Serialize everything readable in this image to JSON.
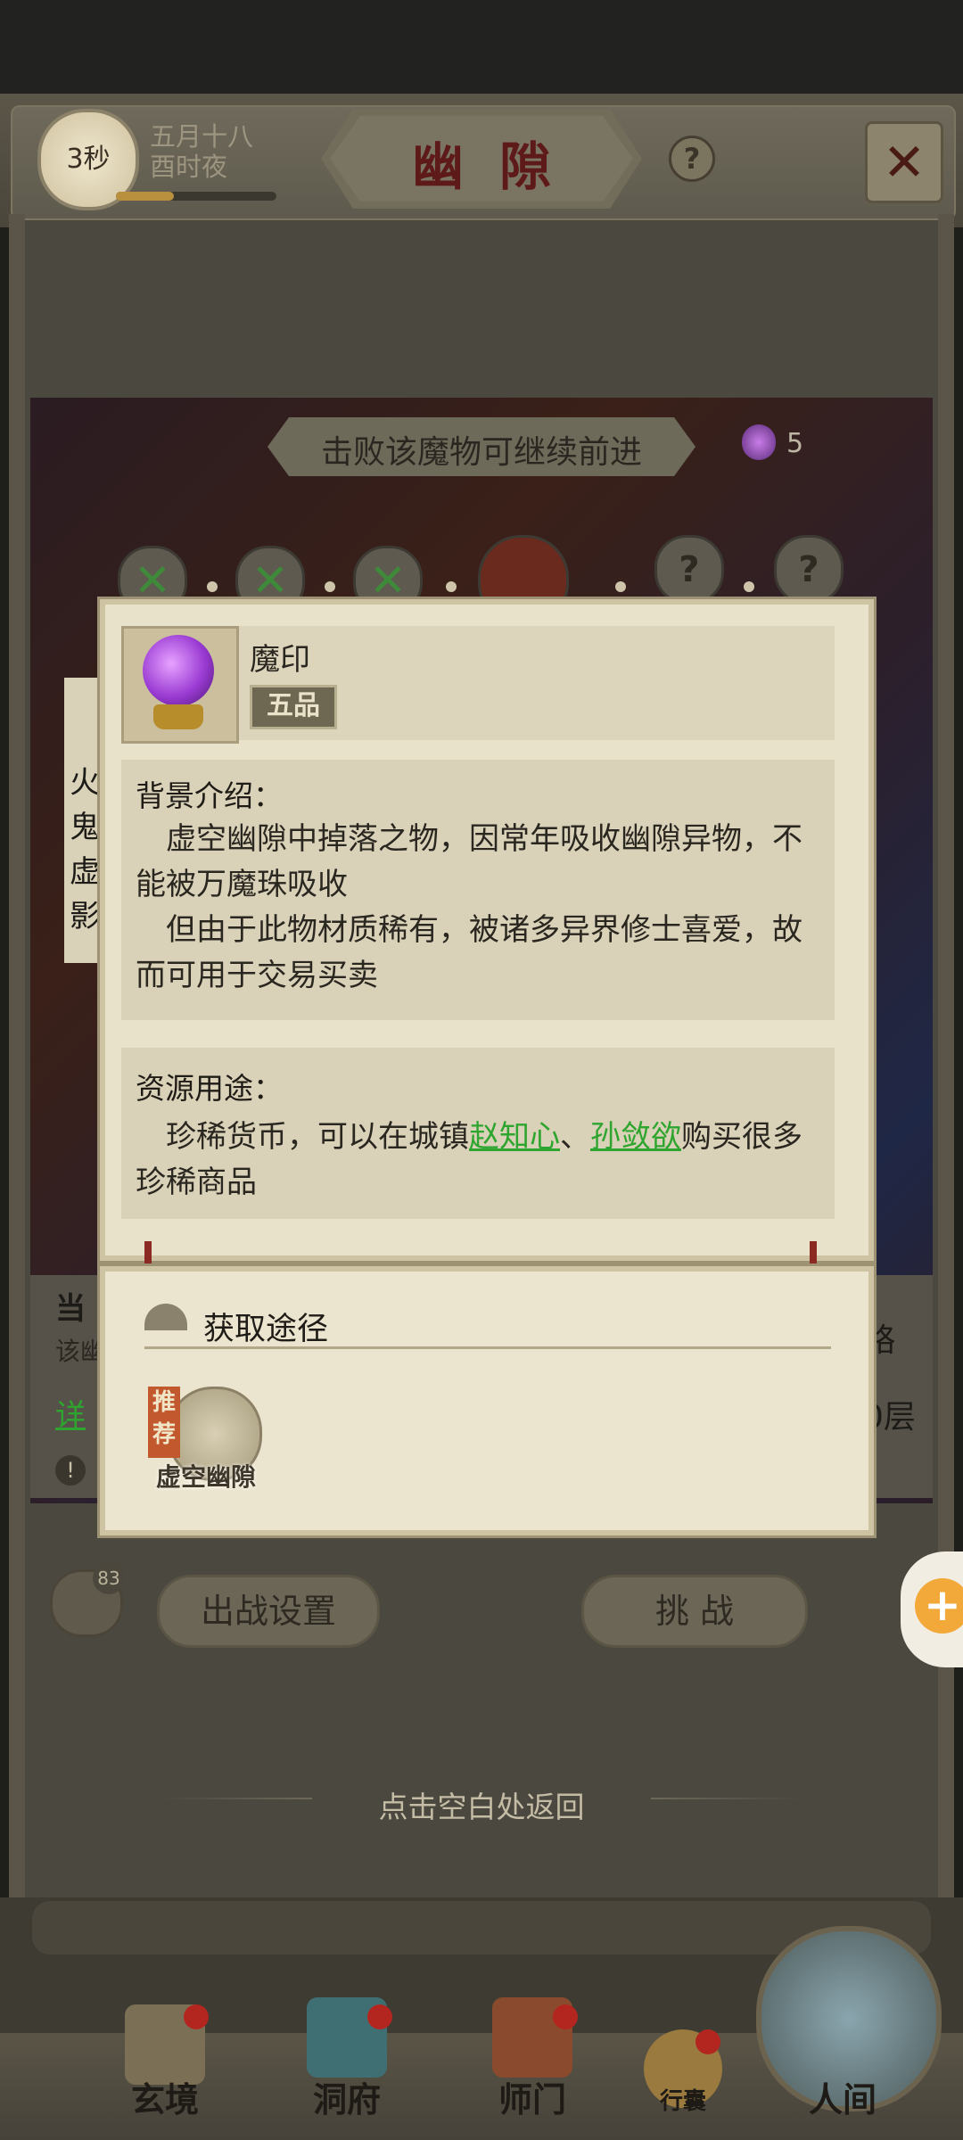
{
  "header": {
    "timer": "3秒",
    "date_line1": "五月十八",
    "date_line2": "酉时夜",
    "title": "幽隙",
    "help_symbol": "?",
    "close_symbol": "✕"
  },
  "stage": {
    "hint": "击败该魔物可继续前进",
    "orb_count": "5",
    "nodes": [
      {
        "state": "cleared",
        "symbol": "✕"
      },
      {
        "state": "cleared",
        "symbol": "✕"
      },
      {
        "state": "cleared",
        "symbol": "✕"
      },
      {
        "state": "current",
        "symbol": ""
      },
      {
        "state": "locked",
        "symbol": "?"
      },
      {
        "state": "locked",
        "symbol": "?"
      }
    ],
    "left_vertical_text": [
      "火",
      "鬼",
      "虚",
      "影"
    ],
    "partial_bottom": {
      "current_label": "当",
      "desc_prefix": "该幽",
      "detail_link": "详",
      "strategy_label": "略",
      "floor_suffix": "0层",
      "warning_symbol": "!"
    }
  },
  "item_popup": {
    "name": "魔印",
    "grade": "五品",
    "background_title": "背景介绍：",
    "background_p1": "虚空幽隙中掉落之物，因常年吸收幽隙异物，不能被万魔珠吸收",
    "background_p2": "但由于此物材质稀有，被诸多异界修士喜爱，故而可用于交易买卖",
    "usage_title": "资源用途：",
    "usage_prefix": "珍稀货币，可以在城镇",
    "usage_link1": "赵知心",
    "usage_sep": "、",
    "usage_link2": "孙敛欲",
    "usage_suffix": "购买很多珍稀商品",
    "accent_color": "#2ea52e"
  },
  "acquire_popup": {
    "title": "获取途径",
    "recommend_badge": "推荐",
    "source_label": "虚空幽隙"
  },
  "actions": {
    "chat_badge": "83",
    "battle_settings": "出战设置",
    "challenge": "挑 战",
    "plus_symbol": "+",
    "return_hint": "点击空白处返回"
  },
  "nav": {
    "items": [
      "玄境",
      "洞府",
      "师门",
      "行囊",
      "人间"
    ]
  }
}
